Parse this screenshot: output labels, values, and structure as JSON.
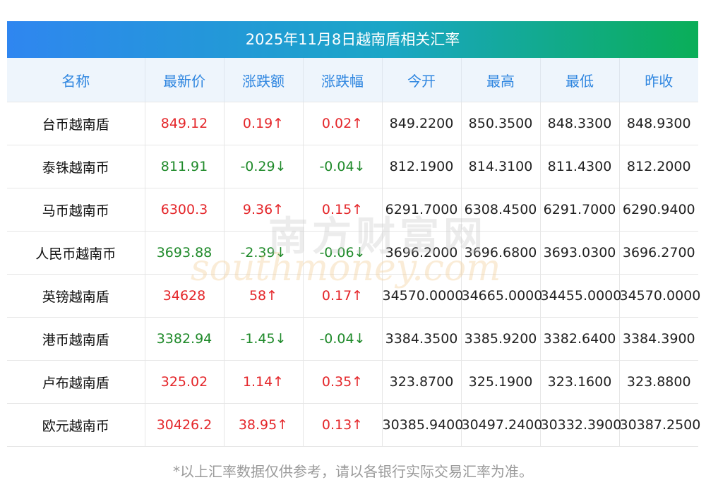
{
  "title": "2025年11月8日越南盾相关汇率",
  "headers": [
    "名称",
    "最新价",
    "涨跌额",
    "涨跌幅",
    "今开",
    "最高",
    "最低",
    "昨收"
  ],
  "rows": [
    {
      "name": "台币越南盾",
      "latest": "849.12",
      "change": "0.19↑",
      "pct": "0.02↑",
      "dir": "up",
      "open": "849.2200",
      "high": "850.3500",
      "low": "848.3300",
      "prev": "848.9300"
    },
    {
      "name": "泰铢越南币",
      "latest": "811.91",
      "change": "-0.29↓",
      "pct": "-0.04↓",
      "dir": "down",
      "open": "812.1900",
      "high": "814.3100",
      "low": "811.4300",
      "prev": "812.2000"
    },
    {
      "name": "马币越南币",
      "latest": "6300.3",
      "change": "9.36↑",
      "pct": "0.15↑",
      "dir": "up",
      "open": "6291.7000",
      "high": "6308.4500",
      "low": "6291.7000",
      "prev": "6290.9400"
    },
    {
      "name": "人民币越南币",
      "latest": "3693.88",
      "change": "-2.39↓",
      "pct": "-0.06↓",
      "dir": "down",
      "open": "3696.2000",
      "high": "3696.6800",
      "low": "3693.0300",
      "prev": "3696.2700"
    },
    {
      "name": "英镑越南盾",
      "latest": "34628",
      "change": "58↑",
      "pct": "0.17↑",
      "dir": "up",
      "open": "34570.0000",
      "high": "34665.0000",
      "low": "34455.0000",
      "prev": "34570.0000"
    },
    {
      "name": "港币越南盾",
      "latest": "3382.94",
      "change": "-1.45↓",
      "pct": "-0.04↓",
      "dir": "down",
      "open": "3384.3500",
      "high": "3385.9200",
      "low": "3382.6400",
      "prev": "3384.3900"
    },
    {
      "name": "卢布越南盾",
      "latest": "325.02",
      "change": "1.14↑",
      "pct": "0.35↑",
      "dir": "up",
      "open": "323.8700",
      "high": "325.1900",
      "low": "323.1600",
      "prev": "323.8800"
    },
    {
      "name": "欧元越南币",
      "latest": "30426.2",
      "change": "38.95↑",
      "pct": "0.13↑",
      "dir": "up",
      "open": "30385.9400",
      "high": "30497.2400",
      "low": "30332.3900",
      "prev": "30387.2500"
    }
  ],
  "watermark": {
    "cn": "南方财富网",
    "en": "southmoney.com"
  },
  "footnote": "*以上汇率数据仅供参考，请以各银行实际交易汇率为准。",
  "colors": {
    "up": "#e4262a",
    "down": "#1f8a2a",
    "header_text": "#2f86e0",
    "header_bg": "#eef5fc"
  }
}
